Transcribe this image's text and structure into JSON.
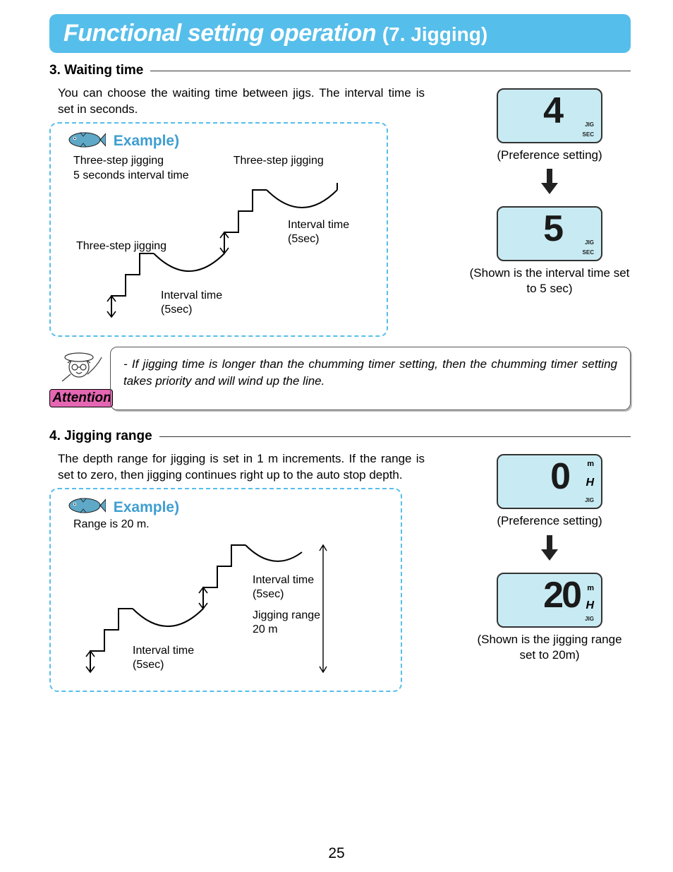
{
  "banner": {
    "main": "Functional setting operation",
    "sub": "(7. Jigging)"
  },
  "sec3": {
    "heading": "3. Waiting time",
    "intro": "You can choose the waiting time between jigs. The interval time is set in seconds.",
    "example_label": "Example)",
    "line1": "Three-step jigging",
    "line2": "5 seconds interval time",
    "three_step_b": "Three-step jigging",
    "three_step_c": "Three-step jigging",
    "interval_a": "Interval time",
    "interval_a2": "(5sec)",
    "interval_b": "Interval time",
    "interval_b2": "(5sec)",
    "disp1": {
      "value": "4",
      "jig": "JIG",
      "sec": "SEC"
    },
    "pref": "(Preference setting)",
    "disp2": {
      "value": "5",
      "jig": "JIG",
      "sec": "SEC"
    },
    "caption": "(Shown is the interval time set to 5 sec)"
  },
  "attention": {
    "label": "Attention",
    "note": "- If jigging time is longer than the chumming timer setting, then the chumming timer setting takes priority and will wind up the line."
  },
  "sec4": {
    "heading": "4. Jigging range",
    "intro": "The depth range for jigging is set in 1 m increments. If the range is set to zero, then jigging continues right up to the auto stop depth.",
    "example_label": "Example)",
    "range_line": "Range is 20 m.",
    "interval_a": "Interval time",
    "interval_a2": "(5sec)",
    "interval_b": "Interval time",
    "interval_b2": "(5sec)",
    "jrange1": "Jigging range",
    "jrange2": "20 m",
    "disp1": {
      "value": "0",
      "m": "m",
      "h": "H",
      "jig": "JIG"
    },
    "pref": "(Preference setting)",
    "disp2": {
      "value": "20",
      "m": "m",
      "h": "H",
      "jig": "JIG"
    },
    "caption": "(Shown is the jigging range set to 20m)"
  },
  "page": "25"
}
